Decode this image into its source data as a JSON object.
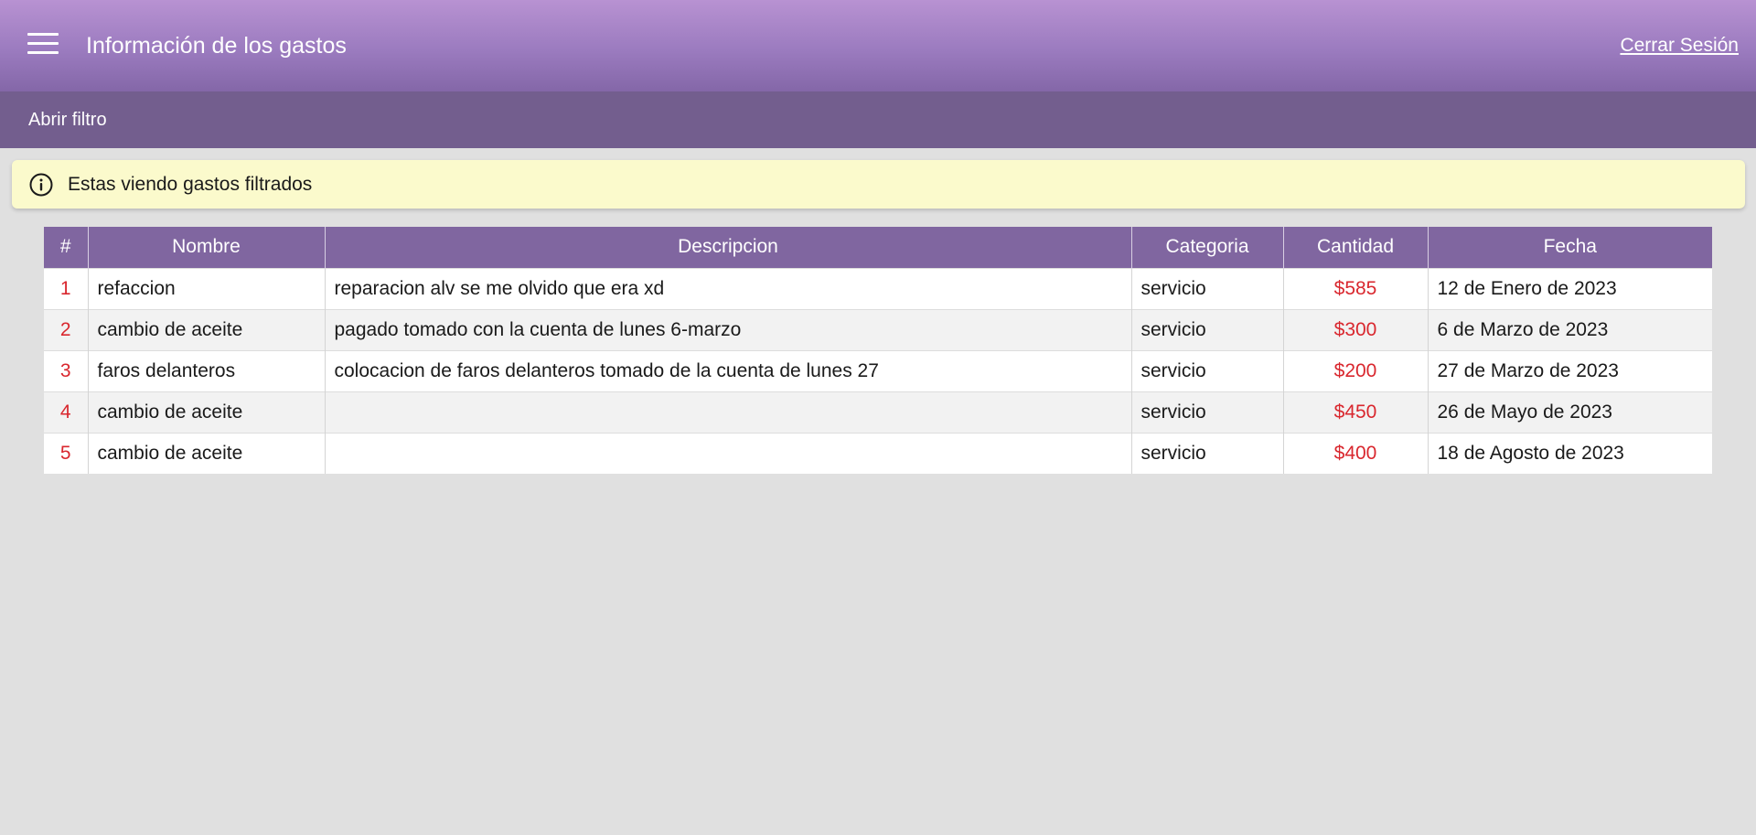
{
  "header": {
    "title": "Información de los gastos",
    "logout_label": "Cerrar Sesión",
    "menu_icon": "hamburger-menu-icon"
  },
  "filter_bar": {
    "open_filter_label": "Abrir filtro"
  },
  "alert": {
    "icon": "info-icon",
    "message": "Estas viendo gastos filtrados"
  },
  "table": {
    "columns": [
      "#",
      "Nombre",
      "Descripcion",
      "Categoria",
      "Cantidad",
      "Fecha"
    ],
    "rows": [
      {
        "num": "1",
        "nombre": "refaccion",
        "descripcion": "reparacion alv se me olvido que era xd",
        "categoria": "servicio",
        "cantidad": "$585",
        "fecha": "12 de Enero de 2023"
      },
      {
        "num": "2",
        "nombre": "cambio de aceite",
        "descripcion": "pagado tomado con la cuenta de lunes 6-marzo",
        "categoria": "servicio",
        "cantidad": "$300",
        "fecha": "6 de Marzo de 2023"
      },
      {
        "num": "3",
        "nombre": "faros delanteros",
        "descripcion": "colocacion de faros delanteros tomado de la cuenta de lunes 27",
        "categoria": "servicio",
        "cantidad": "$200",
        "fecha": "27 de Marzo de 2023"
      },
      {
        "num": "4",
        "nombre": "cambio de aceite",
        "descripcion": "",
        "categoria": "servicio",
        "cantidad": "$450",
        "fecha": "26 de Mayo de 2023"
      },
      {
        "num": "5",
        "nombre": "cambio de aceite",
        "descripcion": "",
        "categoria": "servicio",
        "cantidad": "$400",
        "fecha": "18 de Agosto de 2023"
      }
    ]
  },
  "colors": {
    "header_top": "#b892d2",
    "filter_bar": "#735e8e",
    "table_header": "#8066a0",
    "alert_bg": "#fbfacc",
    "accent_red": "#d9272e"
  }
}
